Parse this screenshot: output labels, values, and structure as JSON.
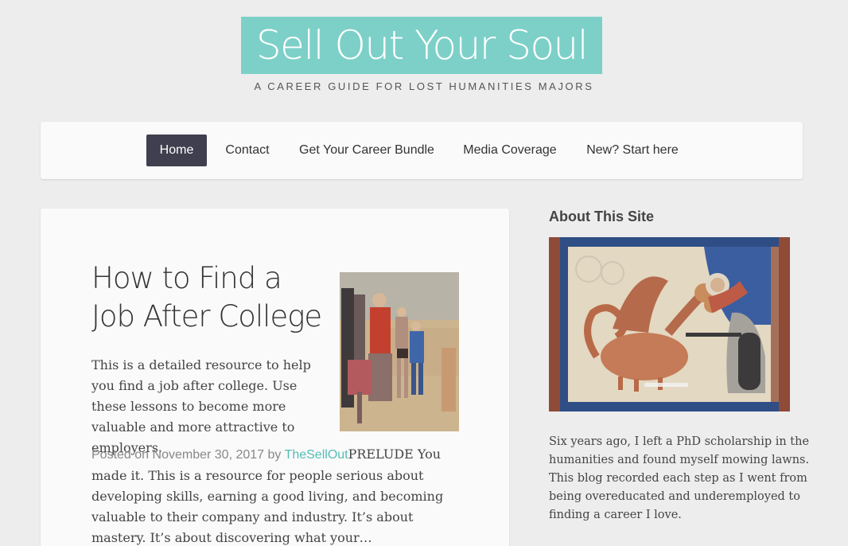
{
  "header": {
    "site_title": "Sell Out Your Soul",
    "tagline": "A CAREER GUIDE FOR LOST HUMANITIES MAJORS"
  },
  "nav": {
    "items": [
      {
        "label": "Home",
        "active": true
      },
      {
        "label": "Contact"
      },
      {
        "label": "Get Your Career Bundle"
      },
      {
        "label": "Media Coverage"
      },
      {
        "label": "New? Start here"
      }
    ]
  },
  "post": {
    "title": "How to Find a Job After College",
    "excerpt": "This is a detailed resource to help you find a job after college. Use these lessons to become more valuable and more attractive to employers.",
    "posted_prefix": "Posted on",
    "date": "November 30, 2017",
    "by": "by",
    "author": "TheSellOut",
    "body": "PRELUDE You made it. This is a resource for people serious about developing skills, earning a good living, and becoming valuable to their company and industry. It’s about mastery. It’s about discovering what your…"
  },
  "sidebar": {
    "widget_title": "About This Site",
    "about_text": "Six years ago, I left a PhD scholarship in the humanities and found myself mowing lawns. This blog recorded each step as I went from being overeducated and underemployed to finding a career I love."
  },
  "colors": {
    "accent": "#7dd0c8",
    "link": "#55bdb4",
    "nav_active": "#3f3f4f",
    "background": "#ededed"
  }
}
